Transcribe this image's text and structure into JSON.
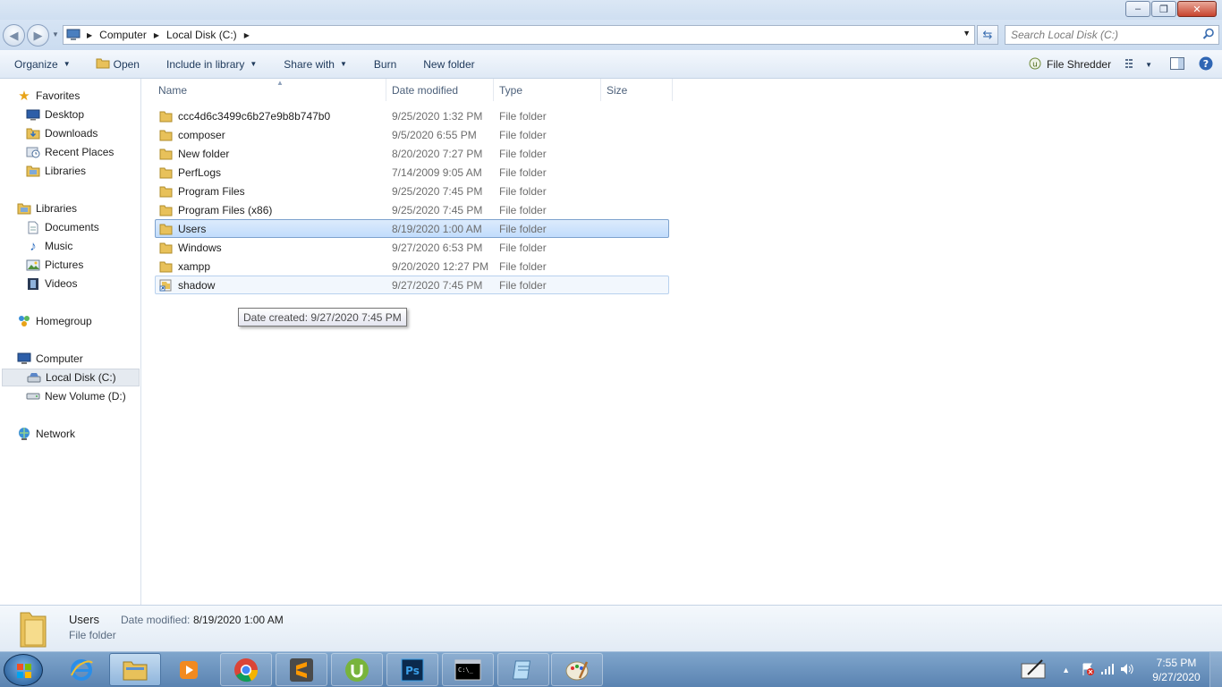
{
  "window": {
    "buttons": {
      "minimize": "–",
      "maximize": "❐",
      "close": "✕"
    }
  },
  "address": {
    "crumbs": [
      "Computer",
      "Local Disk (C:)"
    ],
    "search_placeholder": "Search Local Disk (C:)"
  },
  "toolbar": {
    "organize": "Organize",
    "open": "Open",
    "include_in_library": "Include in library",
    "share_with": "Share with",
    "burn": "Burn",
    "new_folder": "New folder",
    "file_shredder": "File Shredder"
  },
  "nav": {
    "favorites": "Favorites",
    "desktop": "Desktop",
    "downloads": "Downloads",
    "recent_places": "Recent Places",
    "libraries_fav": "Libraries",
    "libraries": "Libraries",
    "documents": "Documents",
    "music": "Music",
    "pictures": "Pictures",
    "videos": "Videos",
    "homegroup": "Homegroup",
    "computer": "Computer",
    "local_disk": "Local Disk (C:)",
    "new_volume": "New Volume (D:)",
    "network": "Network"
  },
  "columns": {
    "name": "Name",
    "date": "Date modified",
    "type": "Type",
    "size": "Size"
  },
  "files": [
    {
      "name": "ccc4d6c3499c6b27e9b8b747b0",
      "date": "9/25/2020 1:32 PM",
      "type": "File folder"
    },
    {
      "name": "composer",
      "date": "9/5/2020 6:55 PM",
      "type": "File folder"
    },
    {
      "name": "New folder",
      "date": "8/20/2020 7:27 PM",
      "type": "File folder"
    },
    {
      "name": "PerfLogs",
      "date": "7/14/2009 9:05 AM",
      "type": "File folder"
    },
    {
      "name": "Program Files",
      "date": "9/25/2020 7:45 PM",
      "type": "File folder"
    },
    {
      "name": "Program Files (x86)",
      "date": "9/25/2020 7:45 PM",
      "type": "File folder"
    },
    {
      "name": "Users",
      "date": "8/19/2020 1:00 AM",
      "type": "File folder"
    },
    {
      "name": "Windows",
      "date": "9/27/2020 6:53 PM",
      "type": "File folder"
    },
    {
      "name": "xampp",
      "date": "9/20/2020 12:27 PM",
      "type": "File folder"
    },
    {
      "name": "shadow",
      "date": "9/27/2020 7:45 PM",
      "type": "File folder"
    }
  ],
  "tooltip": "Date created: 9/27/2020 7:45 PM",
  "details": {
    "name": "Users",
    "label": "Date modified:",
    "value": "8/19/2020 1:00 AM",
    "type": "File folder"
  },
  "clock": {
    "time": "7:55 PM",
    "date": "9/27/2020"
  },
  "colors": {
    "selection": "#cde4fc",
    "taskbar": "#6b92bf",
    "folder": "#e8c15a"
  }
}
